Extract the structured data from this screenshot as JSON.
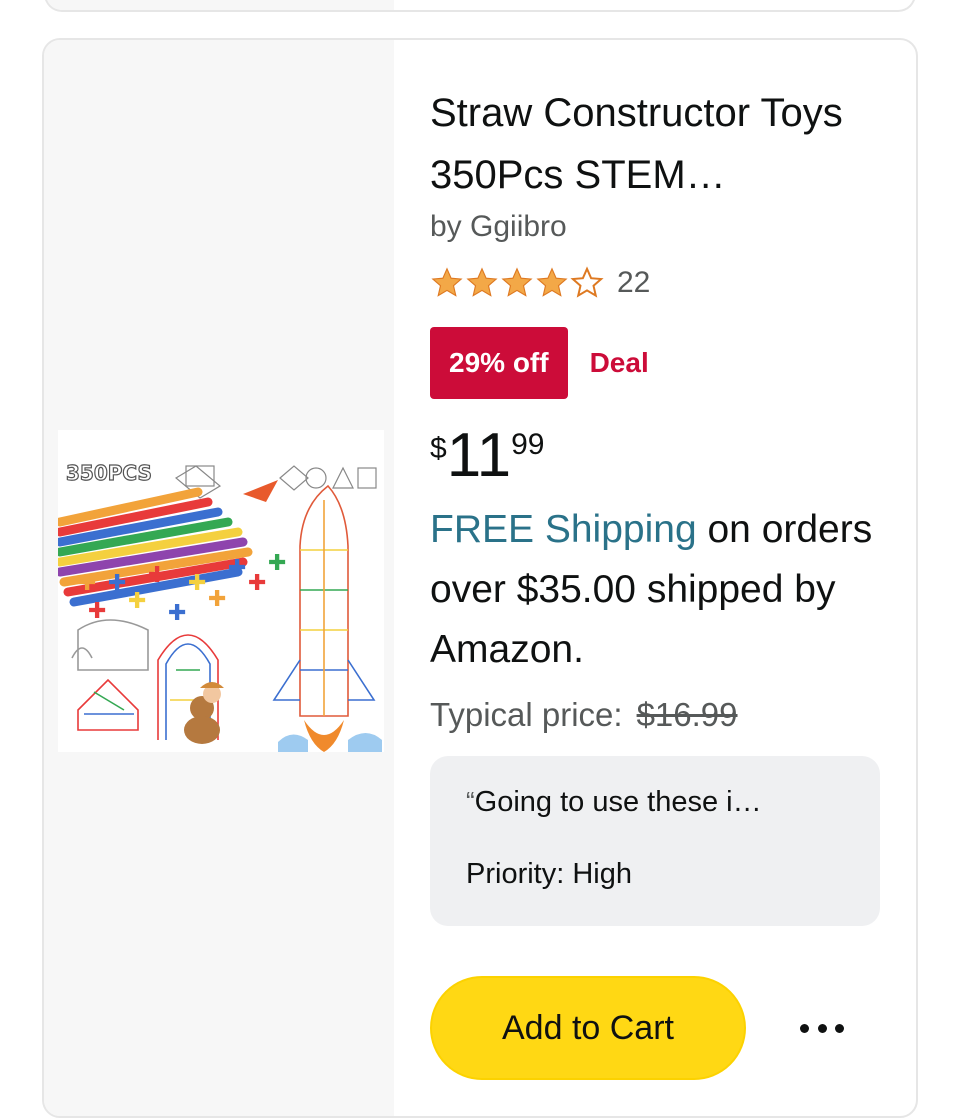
{
  "product": {
    "title": "Straw Constructor Toys 350Pcs STEM…",
    "brand": "by Ggiibro",
    "rating_stars": 4.5,
    "review_count": "22",
    "deal_badge": "29% off",
    "deal_label": "Deal",
    "price": {
      "symbol": "$",
      "whole": "11",
      "fraction": "99"
    },
    "shipping": {
      "free_link": "FREE Shipping",
      "rest": " on orders over $35.00 shipped by Amazon."
    },
    "typical_label": "Typical price:",
    "typical_price": "$16.99",
    "note": {
      "quote_mark": "“",
      "text": "Going to use these i…",
      "priority": "Priority: High"
    },
    "add_to_cart_label": "Add to Cart",
    "image_text": "350PCS"
  },
  "colors": {
    "deal_red": "#cc0c39",
    "link_teal": "#2a7289",
    "cart_yellow": "#ffd814",
    "star_orange": "#f3a847"
  },
  "icons": {
    "more": "more-dots-icon",
    "star": "star-icon"
  }
}
